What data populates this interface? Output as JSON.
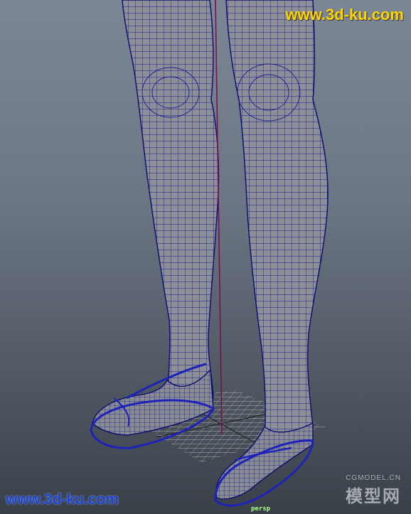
{
  "viewport": {
    "camera_label": "persp",
    "background_top": "#7c8796",
    "background_bottom": "#3a4048",
    "wire_color": "#1a1a8a",
    "mesh_fill": "#8d8f97"
  },
  "watermarks": {
    "top_right": "www.3d-ku.com",
    "bottom_left": "www.3d-ku.com",
    "cgmodel_small": "CGMODEL.CN",
    "cgmodel_large": "模型网"
  }
}
